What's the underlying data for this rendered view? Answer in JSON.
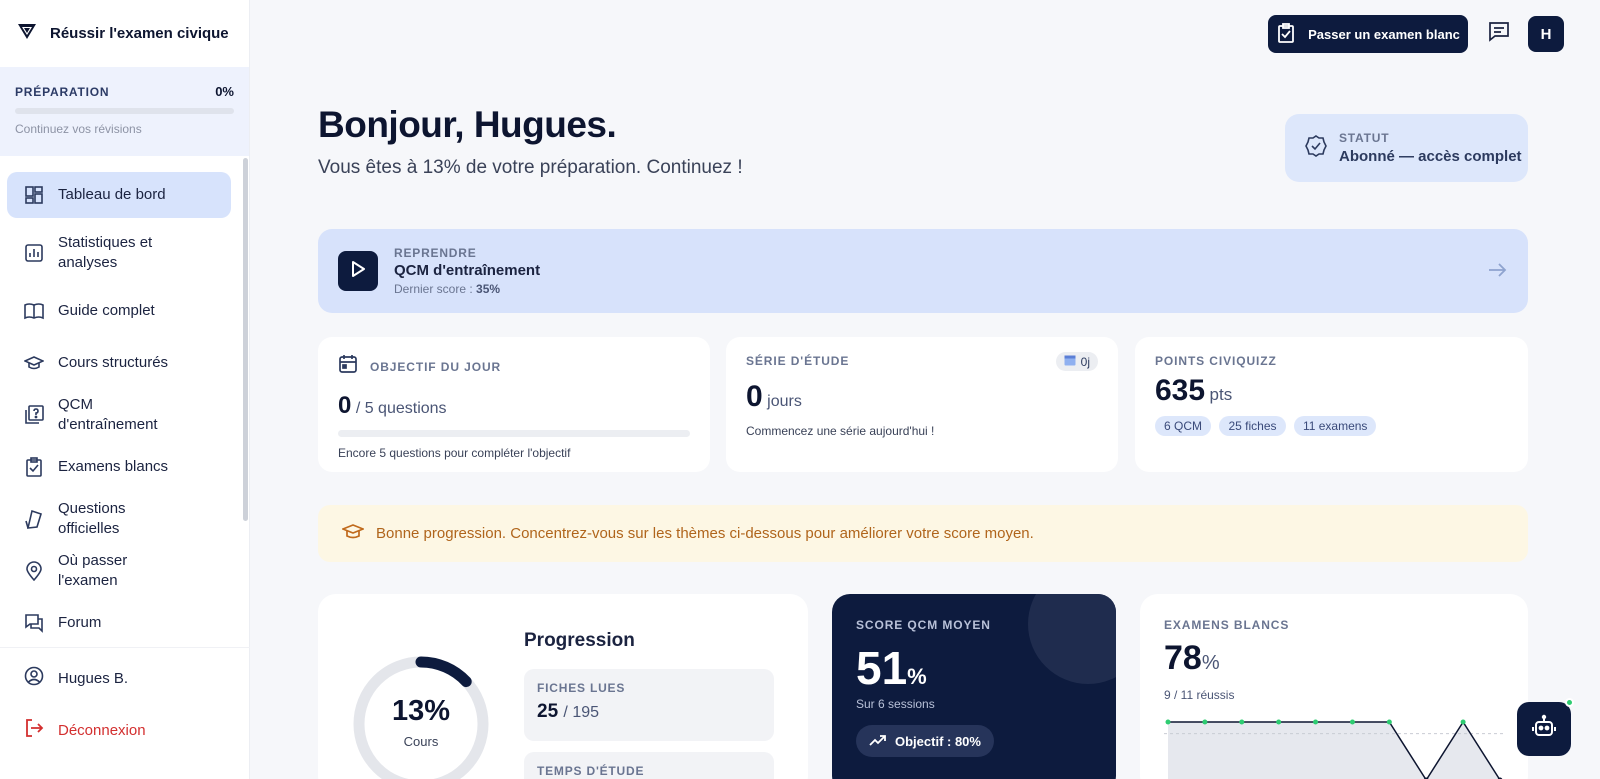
{
  "brand": {
    "title": "Réussir l'examen civique"
  },
  "preparation": {
    "label": "PRÉPARATION",
    "percent": "0%",
    "fraction": 0,
    "hint": "Continuez vos révisions"
  },
  "nav": {
    "items": [
      {
        "label": "Tableau de bord",
        "icon": "dashboard-icon"
      },
      {
        "label": "Statistiques et analyses",
        "icon": "bar-chart-icon"
      },
      {
        "label": "Guide complet",
        "icon": "book-open-icon"
      },
      {
        "label": "Cours structurés",
        "icon": "graduation-cap-icon"
      },
      {
        "label": "QCM d'entraînement",
        "icon": "quiz-icon"
      },
      {
        "label": "Examens blancs",
        "icon": "clipboard-check-icon"
      },
      {
        "label": "Questions officielles",
        "icon": "flag-icon"
      },
      {
        "label": "Où passer l'examen",
        "icon": "map-pin-icon"
      },
      {
        "label": "Forum",
        "icon": "forum-icon"
      }
    ]
  },
  "account": {
    "user": "Hugues B.",
    "logout": "Déconnexion"
  },
  "topbar": {
    "exam_button": "Passer un examen blanc",
    "avatar_initial": "H"
  },
  "greeting": {
    "title": "Bonjour, Hugues.",
    "subtitle": "Vous êtes à 13% de votre préparation. Continuez !"
  },
  "status": {
    "label": "STATUT",
    "value": "Abonné — accès complet"
  },
  "resume": {
    "kicker": "REPRENDRE",
    "title": "QCM d'entraînement",
    "last_score_label": "Dernier score :",
    "last_score": "35%"
  },
  "daily_goal": {
    "label": "OBJECTIF DU JOUR",
    "value": "0",
    "total": "/ 5 questions",
    "fraction": 0,
    "hint": "Encore 5 questions pour compléter l'objectif"
  },
  "streak": {
    "label": "SÉRIE D'ÉTUDE",
    "badge": "0j",
    "value": "0",
    "unit": "jours",
    "hint": "Commencez une série aujourd'hui !"
  },
  "points": {
    "label": "POINTS CIVIQUIZZ",
    "value": "635",
    "unit": "pts",
    "tags": [
      "6 QCM",
      "25 fiches",
      "11 examens"
    ]
  },
  "advice": {
    "text": "Bonne progression. Concentrez-vous sur les thèmes ci-dessous pour améliorer votre score moyen."
  },
  "progression": {
    "title": "Progression",
    "ring_percent": "13%",
    "ring_fraction": 0.13,
    "ring_label": "Cours",
    "fiches_label": "FICHES LUES",
    "fiches_value": "25",
    "fiches_total": "/ 195",
    "time_label": "TEMPS D'ÉTUDE"
  },
  "score": {
    "label": "SCORE QCM MOYEN",
    "value": "51",
    "unit": "%",
    "sub": "Sur 6 sessions",
    "goal": "Objectif : 80%"
  },
  "exams": {
    "label": "EXAMENS BLANCS",
    "value": "78",
    "unit": "%",
    "sub": "9 / 11 réussis"
  },
  "chart_data": {
    "type": "line",
    "series": [
      {
        "values": [
          100,
          100,
          100,
          100,
          100,
          100,
          100,
          0,
          100,
          0
        ]
      }
    ],
    "ylim": [
      0,
      100
    ],
    "threshold": 80,
    "colors": {
      "line": "#0d1530",
      "point": "#2ecc71",
      "area": "#e6e8ee"
    }
  }
}
